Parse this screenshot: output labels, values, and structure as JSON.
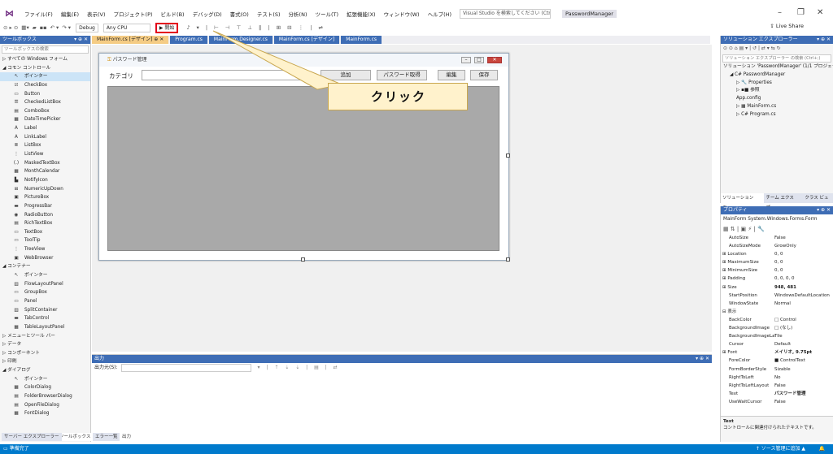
{
  "menu": {
    "items": [
      "ファイル(F)",
      "編集(E)",
      "表示(V)",
      "プロジェクト(P)",
      "ビルド(B)",
      "デバッグ(D)",
      "書式(O)",
      "テスト(S)",
      "分析(N)",
      "ツール(T)",
      "拡張機能(X)",
      "ウィンドウ(W)",
      "ヘルプ(H)"
    ],
    "search_placeholder": "Visual Studio を検索してください (Ctrl...",
    "project": "PasswordManager"
  },
  "toolbar": {
    "config": "Debug",
    "platform": "Any CPU",
    "start_label": "▶ 開始",
    "liveshare": "Live Share"
  },
  "toolbox": {
    "header": "ツールボックス",
    "search_placeholder": "ツールボックスの検索",
    "rows": [
      {
        "t": "cat",
        "label": "▷ すべての Windows フォーム"
      },
      {
        "t": "cat",
        "label": "◢ コモン コントロール"
      },
      {
        "t": "item",
        "icon": "↖",
        "label": "ポインター",
        "sel": true
      },
      {
        "t": "item",
        "icon": "☑",
        "label": "CheckBox"
      },
      {
        "t": "item",
        "icon": "▭",
        "label": "Button"
      },
      {
        "t": "item",
        "icon": "☰",
        "label": "CheckedListBox"
      },
      {
        "t": "item",
        "icon": "▤",
        "label": "ComboBox"
      },
      {
        "t": "item",
        "icon": "▦",
        "label": "DateTimePicker"
      },
      {
        "t": "item",
        "icon": "A",
        "label": "Label"
      },
      {
        "t": "item",
        "icon": "A",
        "label": "LinkLabel"
      },
      {
        "t": "item",
        "icon": "≣",
        "label": "ListBox"
      },
      {
        "t": "item",
        "icon": "⋮",
        "label": "ListView"
      },
      {
        "t": "item",
        "icon": "(.)",
        "label": "MaskedTextBox"
      },
      {
        "t": "item",
        "icon": "▦",
        "label": "MonthCalendar"
      },
      {
        "t": "item",
        "icon": "▙",
        "label": "NotifyIcon"
      },
      {
        "t": "item",
        "icon": "⊞",
        "label": "NumericUpDown"
      },
      {
        "t": "item",
        "icon": "▣",
        "label": "PictureBox"
      },
      {
        "t": "item",
        "icon": "▬",
        "label": "ProgressBar"
      },
      {
        "t": "item",
        "icon": "◉",
        "label": "RadioButton"
      },
      {
        "t": "item",
        "icon": "▤",
        "label": "RichTextBox"
      },
      {
        "t": "item",
        "icon": "▭",
        "label": "TextBox"
      },
      {
        "t": "item",
        "icon": "▭",
        "label": "ToolTip"
      },
      {
        "t": "item",
        "icon": "⋮",
        "label": "TreeView"
      },
      {
        "t": "item",
        "icon": "▣",
        "label": "WebBrowser"
      },
      {
        "t": "cat",
        "label": "◢ コンテナー"
      },
      {
        "t": "item",
        "icon": "↖",
        "label": "ポインター"
      },
      {
        "t": "item",
        "icon": "▥",
        "label": "FlowLayoutPanel"
      },
      {
        "t": "item",
        "icon": "▭",
        "label": "GroupBox"
      },
      {
        "t": "item",
        "icon": "▭",
        "label": "Panel"
      },
      {
        "t": "item",
        "icon": "▥",
        "label": "SplitContainer"
      },
      {
        "t": "item",
        "icon": "▬",
        "label": "TabControl"
      },
      {
        "t": "item",
        "icon": "▦",
        "label": "TableLayoutPanel"
      },
      {
        "t": "cat",
        "label": "▷ メニューとツール バー"
      },
      {
        "t": "cat",
        "label": "▷ データ"
      },
      {
        "t": "cat",
        "label": "▷ コンポーネント"
      },
      {
        "t": "cat",
        "label": "▷ 印刷"
      },
      {
        "t": "cat",
        "label": "◢ ダイアログ"
      },
      {
        "t": "item",
        "icon": "↖",
        "label": "ポインター"
      },
      {
        "t": "item",
        "icon": "▦",
        "label": "ColorDialog"
      },
      {
        "t": "item",
        "icon": "▤",
        "label": "FolderBrowserDialog"
      },
      {
        "t": "item",
        "icon": "▤",
        "label": "OpenFileDialog"
      },
      {
        "t": "item",
        "icon": "▦",
        "label": "FontDialog"
      }
    ]
  },
  "doc_tabs": [
    {
      "label": "MainForm.cs [デザイン]  ⊕ ✕",
      "active": true
    },
    {
      "label": "Program.cs",
      "active": false
    },
    {
      "label": "MainForm.Designer.cs",
      "active": false
    },
    {
      "label": "MainForm.cs [デザイン]",
      "active": false
    },
    {
      "label": "MainForm.cs",
      "active": false
    }
  ],
  "form": {
    "title": "パスワード管理",
    "category_label": "カテゴリ",
    "buttons": {
      "add": "追加",
      "get_password": "パスワード取得",
      "edit": "編集",
      "save": "保存"
    }
  },
  "callout": {
    "text": "クリック"
  },
  "output": {
    "header": "出力",
    "source_label": "出力元(S):"
  },
  "bottom_tabs": {
    "left": [
      "サーバー エクスプローラー",
      "ツールボックス"
    ],
    "center": [
      "エラー一覧",
      "出力"
    ]
  },
  "solution": {
    "header": "ソリューション エクスプローラー",
    "search_placeholder": "ソリューション エクスプローラー の検索 (Ctrl+;)",
    "rows": [
      {
        "indent": 0,
        "label": "ソリューション 'PasswordManager' (1/1 プロジェクト)"
      },
      {
        "indent": 1,
        "label": "◢ C# PasswordManager"
      },
      {
        "indent": 2,
        "label": "▷ 🔧 Properties"
      },
      {
        "indent": 2,
        "label": "▷ ▪■ 参照"
      },
      {
        "indent": 2,
        "label": "  App.config"
      },
      {
        "indent": 2,
        "label": "▷ ▦ MainForm.cs"
      },
      {
        "indent": 2,
        "label": "▷ C# Program.cs"
      }
    ],
    "tabs": [
      "ソリューション エ...",
      "チーム エクスプ...",
      "クラス ビュー"
    ]
  },
  "properties": {
    "header": "プロパティ",
    "object": "MainForm  System.Windows.Forms.Form",
    "rows": [
      {
        "n": "AutoSize",
        "v": "False"
      },
      {
        "n": "AutoSizeMode",
        "v": "GrowOnly"
      },
      {
        "n": "⊞ Location",
        "v": "0, 0",
        "cat": true
      },
      {
        "n": "⊞ MaximumSize",
        "v": "0, 0",
        "cat": true
      },
      {
        "n": "⊞ MinimumSize",
        "v": "0, 0",
        "cat": true
      },
      {
        "n": "⊞ Padding",
        "v": "0, 0, 0, 0",
        "cat": true
      },
      {
        "n": "⊞ Size",
        "v": "948, 481",
        "cat": true,
        "bold": true
      },
      {
        "n": "StartPosition",
        "v": "WindowsDefaultLocation"
      },
      {
        "n": "WindowState",
        "v": "Normal"
      },
      {
        "n": "⊟ 表示",
        "v": "",
        "cat": true
      },
      {
        "n": "BackColor",
        "v": "□ Control"
      },
      {
        "n": "BackgroundImage",
        "v": "□ (なし)"
      },
      {
        "n": "BackgroundImageLayout",
        "v": "Tile"
      },
      {
        "n": "Cursor",
        "v": "Default"
      },
      {
        "n": "⊞ Font",
        "v": "メイリオ, 9.75pt",
        "cat": true,
        "bold": true
      },
      {
        "n": "ForeColor",
        "v": "■ ControlText"
      },
      {
        "n": "FormBorderStyle",
        "v": "Sizable"
      },
      {
        "n": "RightToLeft",
        "v": "No"
      },
      {
        "n": "RightToLeftLayout",
        "v": "False"
      },
      {
        "n": "Text",
        "v": "パスワード管理",
        "bold": true
      },
      {
        "n": "UseWaitCursor",
        "v": "False"
      }
    ],
    "desc_title": "Text",
    "desc_body": "コントロールに関連付けられたテキストです。"
  },
  "status": {
    "left": "準備完了",
    "right": "↑ ソース管理に追加 ▲"
  }
}
